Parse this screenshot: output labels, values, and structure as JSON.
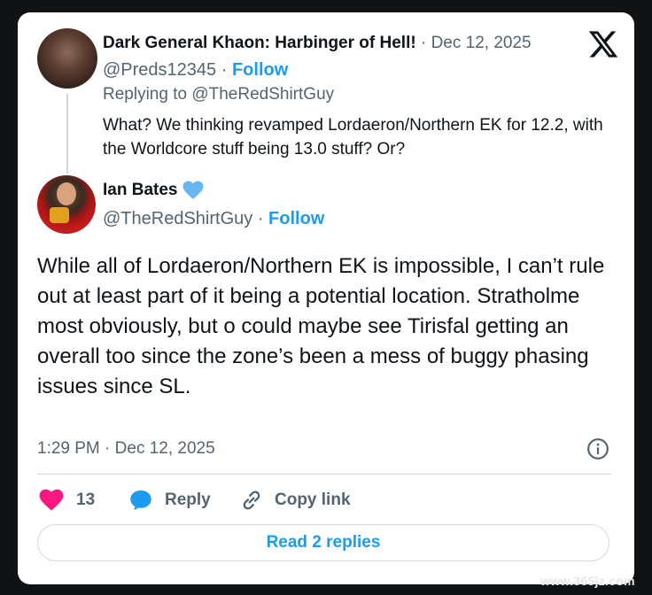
{
  "parent": {
    "display_name": "Dark General Khaon: Harbinger of Hell!",
    "date": "Dec 12, 2025",
    "handle": "@Preds12345",
    "follow_label": "Follow",
    "replying_prefix": "Replying to ",
    "replying_to": "@TheRedShirtGuy",
    "text": "What? We thinking revamped Lordaeron/Northern EK for 12.2, with the Worldcore stuff being 13.0 stuff? Or?"
  },
  "tweet": {
    "display_name": "Ian Bates",
    "verified_icon": "heart-icon",
    "handle": "@TheRedShirtGuy",
    "follow_label": "Follow",
    "text": "While all of Lordaeron/Northern EK is impossible, I can’t rule out at least part of it being a potential location. Stratholme most obviously, but o could maybe see Tirisfal getting an overall too since the zone’s been a mess of buggy phasing issues since SL.",
    "time": "1:29 PM",
    "date": "Dec 12, 2025"
  },
  "actions": {
    "like_count": "13",
    "reply_label": "Reply",
    "copy_link_label": "Copy link",
    "read_replies_label": "Read 2 replies"
  },
  "separator": " · ",
  "watermark": "www.365jz.com",
  "colors": {
    "accent": "#1d9bf0",
    "like": "#f91880",
    "text": "#0f1419",
    "muted": "#536471"
  }
}
